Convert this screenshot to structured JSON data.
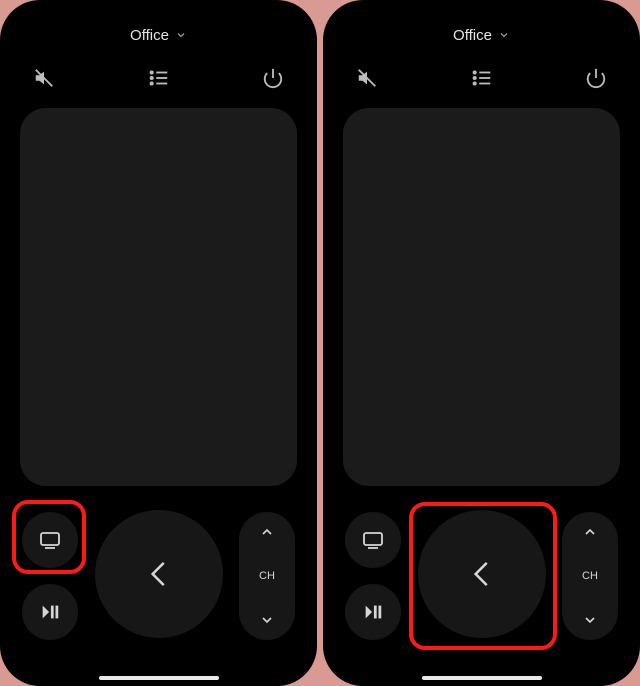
{
  "screens": [
    {
      "device_name": "Office",
      "channel_label": "CH",
      "highlight_target": "tv-button"
    },
    {
      "device_name": "Office",
      "channel_label": "CH",
      "highlight_target": "back-button"
    }
  ]
}
